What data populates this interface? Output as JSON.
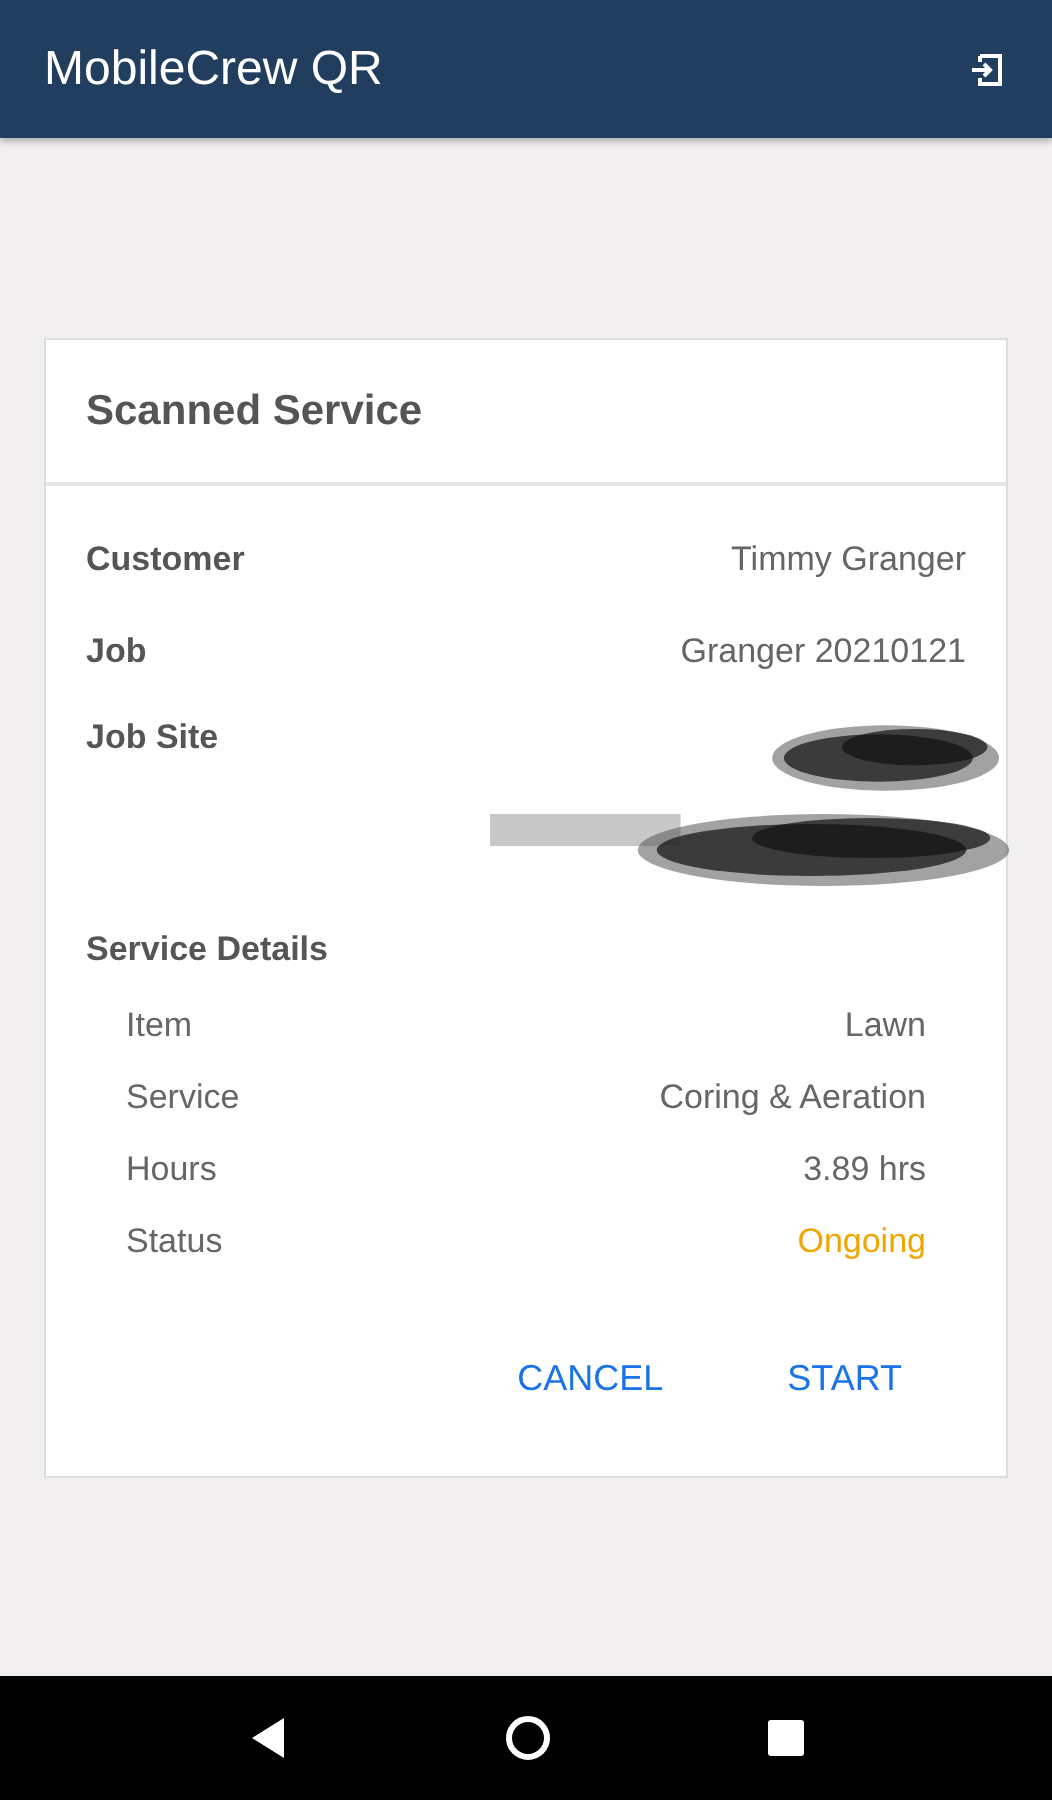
{
  "app_bar": {
    "title": "MobileCrew QR"
  },
  "card": {
    "title": "Scanned Service",
    "fields": [
      {
        "label": "Customer",
        "value": "Timmy Granger"
      },
      {
        "label": "Job",
        "value": "Granger 20210121"
      }
    ],
    "job_site": {
      "label": "Job Site",
      "lines": [
        {
          "kind": "redacted"
        },
        {
          "kind": "redacted"
        }
      ]
    },
    "details_title": "Service Details",
    "details": [
      {
        "label": "Item",
        "value": "Lawn",
        "kind": "plain"
      },
      {
        "label": "Service",
        "value": "Coring & Aeration",
        "kind": "plain"
      },
      {
        "label": "Hours",
        "value": "3.89 hrs",
        "kind": "plain"
      },
      {
        "label": "Status",
        "value": "Ongoing",
        "kind": "status",
        "color": "#f0a500"
      }
    ],
    "buttons": [
      "CANCEL",
      "START"
    ]
  }
}
